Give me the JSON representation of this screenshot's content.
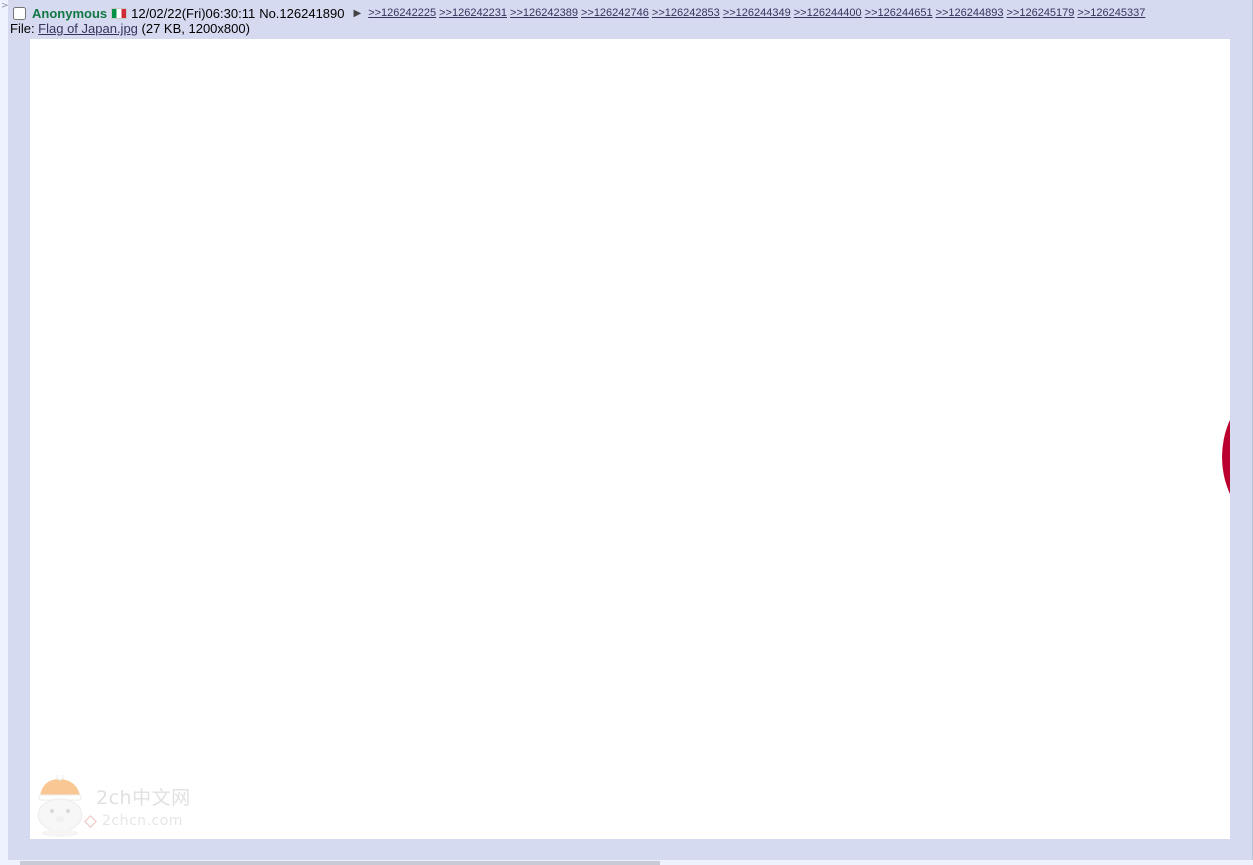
{
  "post": {
    "name": "Anonymous",
    "flag_country": "Italy",
    "date": "12/02/22(Fri)06:30:11",
    "no_label": "No.",
    "number": "126241890",
    "menu_icon": "triangle-right-icon",
    "backlinks": [
      ">>126242225",
      ">>126242231",
      ">>126242389",
      ">>126242746",
      ">>126242853",
      ">>126244349",
      ">>126244400",
      ">>126244651",
      ">>126244893",
      ">>126245179",
      ">>126245337"
    ]
  },
  "file": {
    "label": "File: ",
    "filename": "Flag of Japan.jpg",
    "details": " (27 KB, 1200x800)"
  },
  "watermark": {
    "title": "2ch中文网",
    "url": "2chcn.com"
  },
  "colors": {
    "post_bg": "#d6daf0",
    "name": "#117743",
    "link": "#34345c",
    "flag_red": "#bc002d"
  }
}
